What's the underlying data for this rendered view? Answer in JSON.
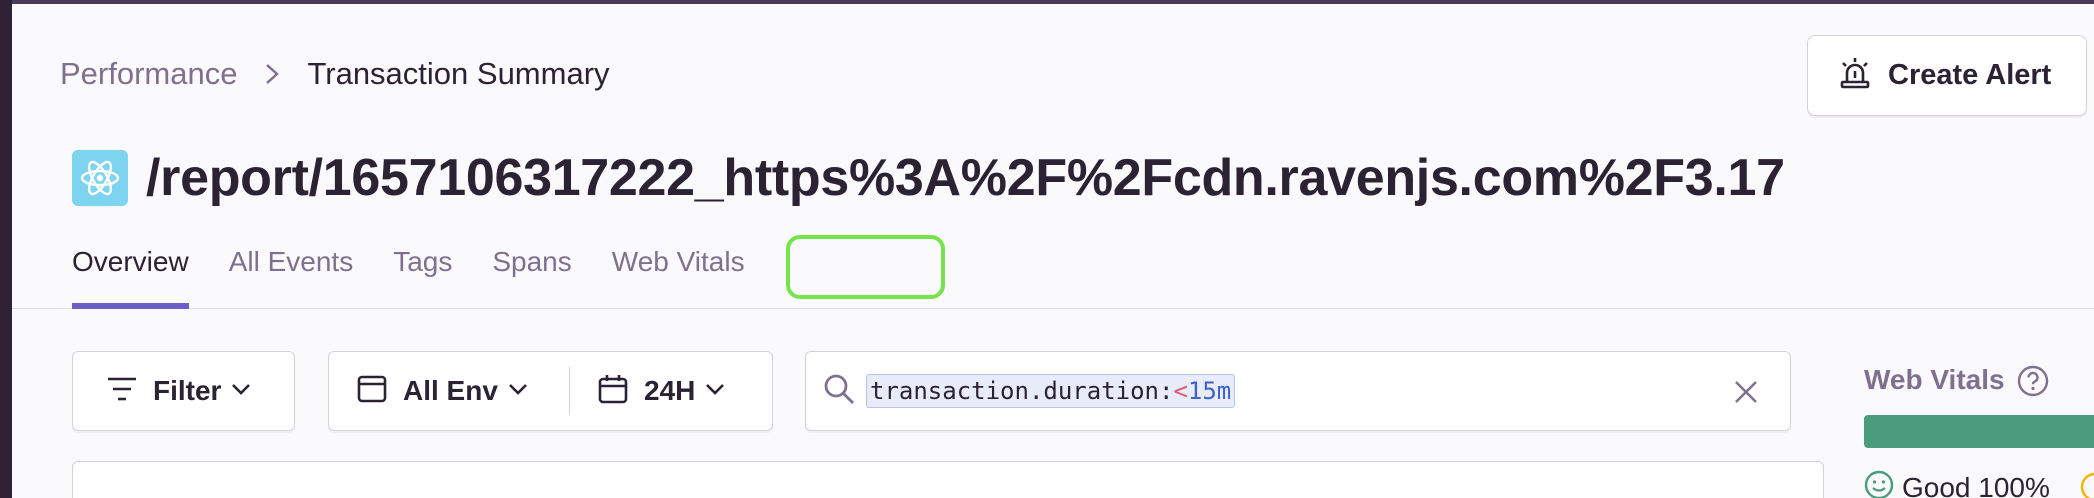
{
  "breadcrumb": {
    "parent": "Performance",
    "current": "Transaction Summary"
  },
  "header": {
    "title": "/report/1657106317222_https%3A%2F%2Fcdn.ravenjs.com%2F3.17",
    "platform_icon": "react-atom-icon",
    "create_alert_label": "Create Alert",
    "create_alert_icon": "siren-icon"
  },
  "tabs": [
    {
      "label": "Overview",
      "active": true
    },
    {
      "label": "All Events",
      "active": false
    },
    {
      "label": "Tags",
      "active": false
    },
    {
      "label": "Spans",
      "active": false
    },
    {
      "label": "Web Vitals",
      "active": false
    }
  ],
  "filters": {
    "filter_label": "Filter",
    "environment_label": "All Env",
    "date_label": "24H"
  },
  "search": {
    "token_key": "transaction.duration:",
    "token_op": "<",
    "token_value": "15m"
  },
  "web_vitals": {
    "title": "Web Vitals",
    "good_label": "Good 100%",
    "good_percent": 100
  },
  "colors": {
    "accent": "#6c5fc7",
    "highlight": "#75e34a",
    "good": "#4b9c7c",
    "platform_icon_bg": "#7ed3ef"
  }
}
